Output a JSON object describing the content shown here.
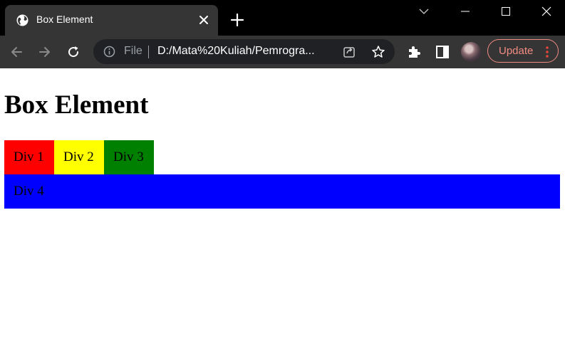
{
  "browser": {
    "tab": {
      "title": "Box Element"
    },
    "address_bar": {
      "scheme_label": "File",
      "url": "D:/Mata%20Kuliah/Pemrogra..."
    },
    "update_button": {
      "label": "Update"
    },
    "colors": {
      "titlebar": "#000000",
      "toolbar": "#353535",
      "omnibox": "#202124",
      "update_accent": "#f28b82"
    }
  },
  "page": {
    "heading": "Box Element",
    "boxes": [
      {
        "label": "Div 1",
        "color": "#ff0000"
      },
      {
        "label": "Div 2",
        "color": "#ffff00"
      },
      {
        "label": "Div 3",
        "color": "#008000"
      },
      {
        "label": "Div 4",
        "color": "#0000ff"
      }
    ]
  },
  "icons": [
    "globe-icon",
    "close-icon",
    "plus-icon",
    "chevron-down-icon",
    "minimize-icon",
    "maximize-icon",
    "window-close-icon",
    "back-arrow-icon",
    "forward-arrow-icon",
    "reload-icon",
    "info-icon",
    "share-icon",
    "star-icon",
    "puzzle-icon",
    "side-panel-icon",
    "kebab-menu-icon"
  ]
}
